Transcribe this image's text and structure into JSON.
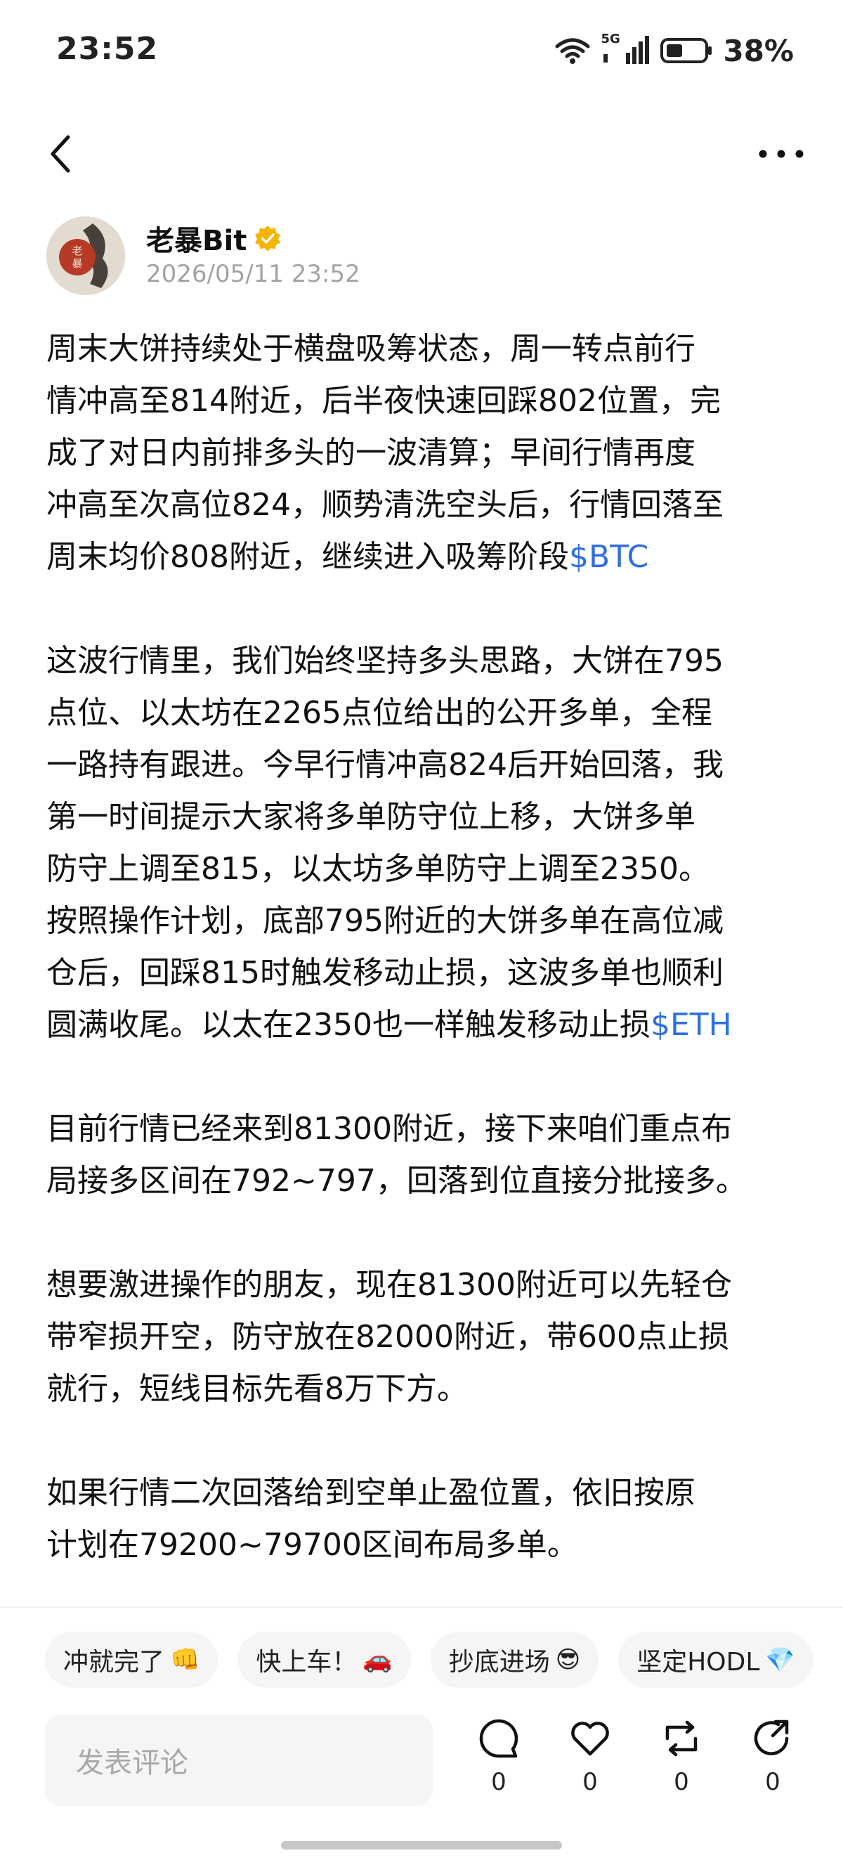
{
  "status_bar": {
    "time": "23:52",
    "network": "5G",
    "battery": "38%",
    "icons": [
      "wifi-icon",
      "cellular-signal-icon",
      "battery-icon"
    ]
  },
  "nav": {
    "back_icon": "chevron-left-icon",
    "more_icon": "more-dots-icon"
  },
  "author": {
    "name": "老暴Bit",
    "timestamp": "2026/05/11 23:52",
    "avatar_text": "老暴",
    "verified_icon": "verified-badge-icon",
    "verified_color": "#f5b400"
  },
  "post": {
    "ticker_color": "#2f6fe0",
    "p1": "周末大饼持续处于横盘吸筹状态，周一转点前行\n情冲高至814附近，后半夜快速回踩802位置，完\n成了对日内前排多头的一波清算；早间行情再度\n冲高至次高位824，顺势清洗空头后，行情回落至\n周末均价808附近，继续进入吸筹阶段",
    "p1_ticker": "$BTC",
    "p2": "这波行情里，我们始终坚持多头思路，大饼在795\n点位、以太坊在2265点位给出的公开多单，全程\n一路持有跟进。今早行情冲高824后开始回落，我\n第一时间提示大家将多单防守位上移，大饼多单\n防守上调至815，以太坊多单防守上调至2350。\n按照操作计划，底部795附近的大饼多单在高位减\n仓后，回踩815时触发移动止损，这波多单也顺利\n圆满收尾。以太在2350也一样触发移动止损",
    "p2_ticker": "$ETH",
    "p3": "目前行情已经来到81300附近，接下来咱们重点布\n局接多区间在792~797，回落到位直接分批接多。",
    "p4": "想要激进操作的朋友，现在81300附近可以先轻仓\n带窄损开空，防守放在82000附近，带600点止损\n就行，短线目标先看8万下方。",
    "p5": "如果行情二次回落给到空单止盈位置，依旧按原\n计划在79200~79700区间布局多单。"
  },
  "quick_replies": [
    {
      "label": "冲就完了",
      "emoji": "👊"
    },
    {
      "label": "快上车！",
      "emoji": "🚗"
    },
    {
      "label": "抄底进场",
      "emoji": "😎"
    },
    {
      "label": "坚定HODL",
      "emoji": "💎"
    }
  ],
  "comment": {
    "placeholder": "发表评论"
  },
  "actions": {
    "comment": {
      "icon": "comment-icon",
      "count": "0"
    },
    "like": {
      "icon": "heart-icon",
      "count": "0"
    },
    "repost": {
      "icon": "repost-icon",
      "count": "0"
    },
    "share": {
      "icon": "share-icon",
      "count": "0"
    }
  }
}
